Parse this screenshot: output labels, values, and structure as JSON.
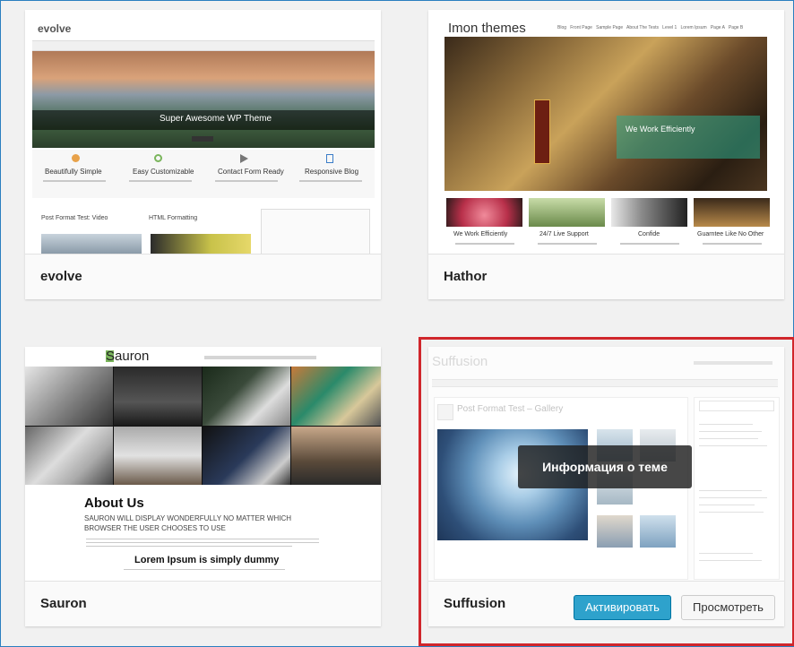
{
  "themes": [
    {
      "name": "evolve",
      "preview": {
        "logo": "evolve",
        "hero_title": "Super Awesome WP Theme",
        "features": [
          "Beautifully Simple",
          "Easy Customizable",
          "Contact Form Ready",
          "Responsive Blog"
        ],
        "posts": [
          "Post Format Test: Video",
          "HTML Formatting"
        ]
      }
    },
    {
      "name": "Hathor",
      "preview": {
        "logo": "Imon themes",
        "nav": [
          "Blog",
          "Front Page",
          "Sample Page",
          "About The Tests",
          "Level 1",
          "Lorem Ipsum",
          "Page A",
          "Page B"
        ],
        "hero_caption": "We Work Efficiently",
        "features": [
          "We Work Efficiently",
          "24/7 Live Support",
          "Confide",
          "Guarntee Like No Other"
        ]
      }
    },
    {
      "name": "Sauron",
      "preview": {
        "logo": "Sauron",
        "about_title": "About Us",
        "about_text": "SAURON WILL DISPLAY WONDERFULLY NO MATTER WHICH BROWSER THE USER CHOOSES TO USE",
        "lorem_title": "Lorem Ipsum is simply dummy"
      }
    },
    {
      "name": "Suffusion",
      "preview": {
        "logo": "Suffusion",
        "post_title": "Post Format Test – Gallery"
      },
      "tooltip": "Информация о теме",
      "activate_label": "Активировать",
      "preview_label": "Просмотреть"
    }
  ],
  "colors": {
    "frame_border": "#2a7fc0",
    "selected_border": "#d0262b",
    "primary_button": "#2ea2cc"
  }
}
